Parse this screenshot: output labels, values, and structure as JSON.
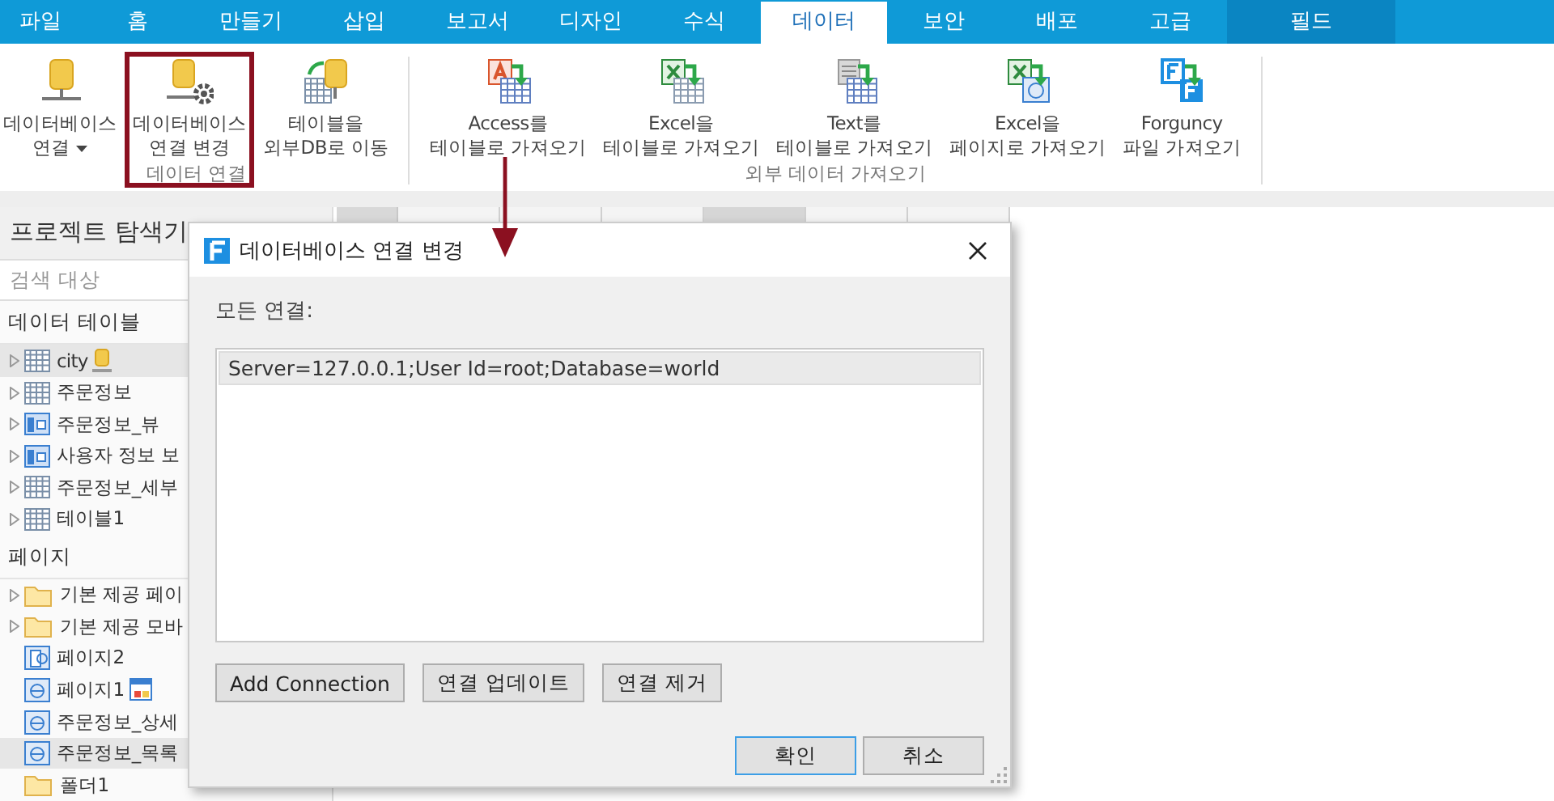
{
  "tabs": [
    {
      "label": "파일",
      "selected": false,
      "kind": "normal"
    },
    {
      "label": "홈",
      "selected": false,
      "kind": "normal"
    },
    {
      "label": "만들기",
      "selected": false,
      "kind": "normal"
    },
    {
      "label": "삽입",
      "selected": false,
      "kind": "normal"
    },
    {
      "label": "보고서",
      "selected": false,
      "kind": "normal"
    },
    {
      "label": "디자인",
      "selected": false,
      "kind": "normal"
    },
    {
      "label": "수식",
      "selected": false,
      "kind": "normal"
    },
    {
      "label": "데이터",
      "selected": true,
      "kind": "normal"
    },
    {
      "label": "보안",
      "selected": false,
      "kind": "normal"
    },
    {
      "label": "배포",
      "selected": false,
      "kind": "normal"
    },
    {
      "label": "고급",
      "selected": false,
      "kind": "normal"
    },
    {
      "label": "필드",
      "selected": false,
      "kind": "contextual"
    }
  ],
  "ribbon": {
    "groups": [
      {
        "label": "데이터 연결",
        "buttons": [
          {
            "lines": [
              "데이터베이스",
              "연결"
            ],
            "kind": "database",
            "dropdown": true,
            "highlighted": false
          },
          {
            "lines": [
              "데이터베이스",
              "연결 변경"
            ],
            "kind": "database-settings",
            "dropdown": false,
            "highlighted": true
          },
          {
            "lines": [
              "테이블을",
              "외부DB로 이동"
            ],
            "kind": "table-move",
            "dropdown": false,
            "highlighted": false
          }
        ]
      },
      {
        "label": "외부 데이터 가져오기",
        "buttons": [
          {
            "lines": [
              "Access를",
              "테이블로 가져오기"
            ],
            "kind": "access",
            "dropdown": false,
            "highlighted": false
          },
          {
            "lines": [
              "Excel을",
              "테이블로 가져오기"
            ],
            "kind": "excel",
            "dropdown": false,
            "highlighted": false
          },
          {
            "lines": [
              "Text를",
              "테이블로 가져오기"
            ],
            "kind": "text",
            "dropdown": false,
            "highlighted": false
          },
          {
            "lines": [
              "Excel을",
              "페이지로 가져오기"
            ],
            "kind": "excel-page",
            "dropdown": false,
            "highlighted": false
          },
          {
            "lines": [
              "Forguncy",
              "파일 가져오기"
            ],
            "kind": "forguncy",
            "dropdown": false,
            "highlighted": false
          }
        ]
      }
    ]
  },
  "sidebar": {
    "title": "프로젝트 탐색기",
    "search": {
      "placeholder": "검색 대상"
    },
    "sections": [
      {
        "label": "데이터 테이블",
        "items": [
          {
            "label": "city",
            "kind": "table",
            "expander": true,
            "selected": true,
            "linked": true
          },
          {
            "label": "주문정보",
            "kind": "table",
            "expander": true,
            "selected": false
          },
          {
            "label": "주문정보_뷰",
            "kind": "view",
            "expander": true,
            "selected": false
          },
          {
            "label": "사용자 정보 보",
            "kind": "view",
            "expander": true,
            "selected": false
          },
          {
            "label": "주문정보_세부",
            "kind": "table",
            "expander": true,
            "selected": false
          },
          {
            "label": "테이블1",
            "kind": "table",
            "expander": true,
            "selected": false
          }
        ]
      },
      {
        "label": "페이지",
        "items": [
          {
            "label": "기본 제공 페이",
            "kind": "folder",
            "expander": true,
            "selected": false
          },
          {
            "label": "기본 제공 모바",
            "kind": "folder",
            "expander": true,
            "selected": false
          },
          {
            "label": "페이지2",
            "kind": "mobile-page",
            "expander": false,
            "selected": false
          },
          {
            "label": "페이지1",
            "kind": "page",
            "expander": false,
            "selected": false,
            "start_page": true
          },
          {
            "label": "주문정보_상세",
            "kind": "page",
            "expander": false,
            "selected": false
          },
          {
            "label": "주문정보_목록",
            "kind": "page",
            "expander": false,
            "selected": true
          },
          {
            "label": "폴더1",
            "kind": "folder",
            "expander": false,
            "selected": false
          }
        ]
      }
    ]
  },
  "sheet": {
    "columns": [
      {
        "selected": false
      },
      {
        "selected": false
      },
      {
        "selected": false
      },
      {
        "selected": true
      },
      {
        "selected": false
      },
      {
        "selected": false
      }
    ]
  },
  "dialog": {
    "title": "데이터베이스 연결 변경",
    "list_label": "모든 연결:",
    "connections": [
      {
        "text": "Server=127.0.0.1;User Id=root;Database=world",
        "selected": true
      }
    ],
    "actions": [
      "Add Connection",
      "연결 업데이트",
      "연결 제거"
    ],
    "buttons": [
      {
        "label": "확인",
        "default": true
      },
      {
        "label": "취소",
        "default": false
      }
    ]
  }
}
